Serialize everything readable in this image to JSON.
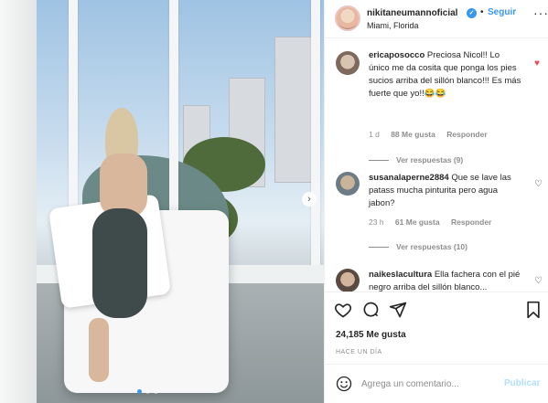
{
  "post": {
    "username": "nikitaneumannoficial",
    "verified": true,
    "separator": "•",
    "follow_label": "Seguir",
    "location": "Miami, Florida",
    "more_icon": "more-horizontal-icon"
  },
  "media": {
    "carousel_dots": 3,
    "active_dot": 0,
    "next_icon": "chevron-right-icon"
  },
  "comments": [
    {
      "username": "ericaposocco",
      "text": "Preciosa Nicol!! Lo único me da cosita que ponga los pies sucios arriba del sillón blanco!!! Es más fuerte que yo!!😂😂",
      "time": "1 d",
      "likes": "88 Me gusta",
      "reply_label": "Responder",
      "replies_label": "Ver respuestas (9)",
      "liked": true
    },
    {
      "username": "susanalaperne2884",
      "text": "Que se lave las patass mucha pinturita pero agua jabon?",
      "time": "23 h",
      "likes": "61 Me gusta",
      "reply_label": "Responder",
      "replies_label": "Ver respuestas (10)",
      "liked": false
    },
    {
      "username": "naikeslacultura",
      "text": "Ella fachera con el pié negro arriba del sillón blanco...",
      "liked": false
    }
  ],
  "actions": {
    "like_icon": "heart-icon",
    "comment_icon": "comment-icon",
    "share_icon": "share-icon",
    "save_icon": "bookmark-icon",
    "likes_count": "24,185",
    "likes_label": "Me gusta",
    "timestamp": "HACE UN DÍA"
  },
  "composer": {
    "emoji_icon": "emoji-icon",
    "placeholder": "Agrega un comentario...",
    "publish_label": "Publicar"
  },
  "colors": {
    "accent": "#3897f0",
    "like_red": "#ed4956",
    "muted": "#8e8e8e",
    "text": "#262626"
  }
}
